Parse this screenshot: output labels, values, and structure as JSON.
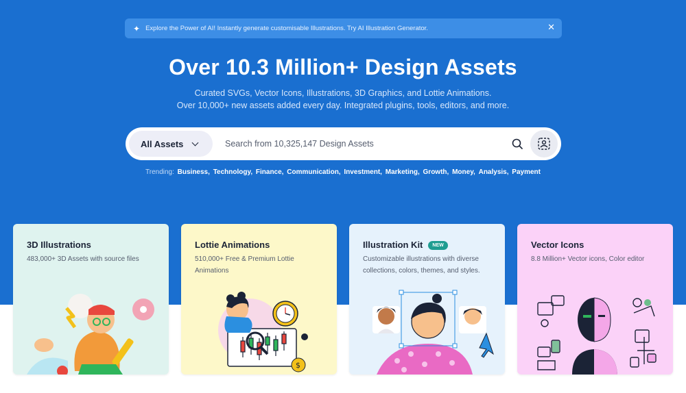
{
  "banner": {
    "text": "Explore the Power of AI! Instantly generate customisable Illustrations. Try AI Illustration Generator.",
    "icon": "sparkle-icon",
    "close_icon": "close-icon"
  },
  "hero": {
    "title": "Over 10.3 Million+ Design Assets",
    "subtitle_1": "Curated SVGs, Vector Icons, Illustrations, 3D Graphics, and Lottie Animations.",
    "subtitle_2": "Over 10,000+ new assets added every day. Integrated plugins, tools, editors, and more."
  },
  "search": {
    "category": "All Assets",
    "placeholder": "Search from 10,325,147 Design Assets"
  },
  "trending": {
    "label": "Trending:",
    "items": [
      "Business,",
      "Technology,",
      "Finance,",
      "Communication,",
      "Investment,",
      "Marketing,",
      "Growth,",
      "Money,",
      "Analysis,",
      "Payment"
    ]
  },
  "cards": [
    {
      "title": "3D Illustrations",
      "desc": "483,000+ 3D Assets with source files",
      "bg": "#dff3ef"
    },
    {
      "title": "Lottie Animations",
      "desc": "510,000+ Free & Premium Lottie Animations",
      "bg": "#fdf8c9"
    },
    {
      "title": "Illustration Kit",
      "badge": "NEW",
      "desc": "Customizable illustrations with diverse collections, colors, themes, and styles.",
      "bg": "#e6f2fc"
    },
    {
      "title": "Vector Icons",
      "desc": "8.8 Million+ Vector icons, Color editor",
      "bg": "#fbd2f8"
    }
  ],
  "colors": {
    "hero_bg": "#1a6fd0",
    "badge": "#1f9d91"
  }
}
